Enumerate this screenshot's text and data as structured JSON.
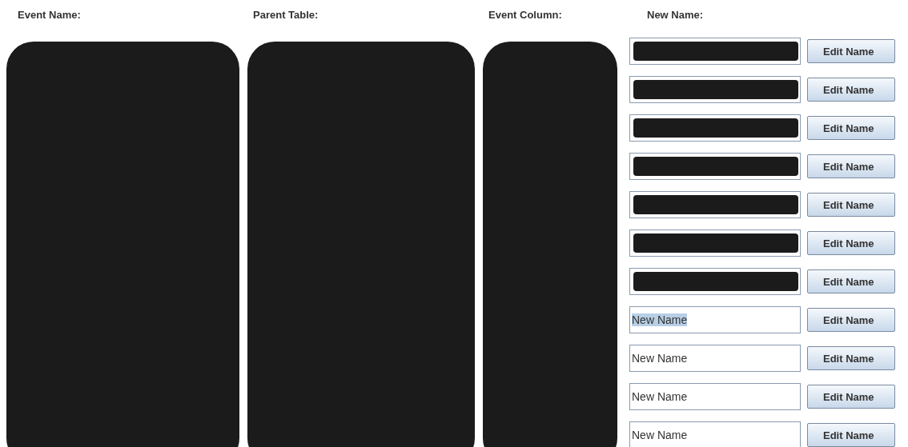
{
  "columns": [
    {
      "title": "Event Name:"
    },
    {
      "title": "Parent Table:"
    },
    {
      "title": "Event Column:"
    },
    {
      "title": "New Name:"
    }
  ],
  "rows": [
    {
      "value": "",
      "redacted": true,
      "button": "Edit Name"
    },
    {
      "value": "",
      "redacted": true,
      "button": "Edit Name"
    },
    {
      "value": "",
      "redacted": true,
      "button": "Edit Name"
    },
    {
      "value": "",
      "redacted": true,
      "button": "Edit Name"
    },
    {
      "value": "",
      "redacted": true,
      "button": "Edit Name"
    },
    {
      "value": "",
      "redacted": true,
      "button": "Edit Name"
    },
    {
      "value": "",
      "redacted": true,
      "button": "Edit Name"
    },
    {
      "value": "New Name",
      "redacted": false,
      "selected": true,
      "button": "Edit Name"
    },
    {
      "value": "New Name",
      "redacted": false,
      "selected": false,
      "button": "Edit Name"
    },
    {
      "value": "New Name",
      "redacted": false,
      "selected": false,
      "button": "Edit Name"
    },
    {
      "value": "New Name",
      "redacted": false,
      "selected": false,
      "button": "Edit Name"
    }
  ]
}
